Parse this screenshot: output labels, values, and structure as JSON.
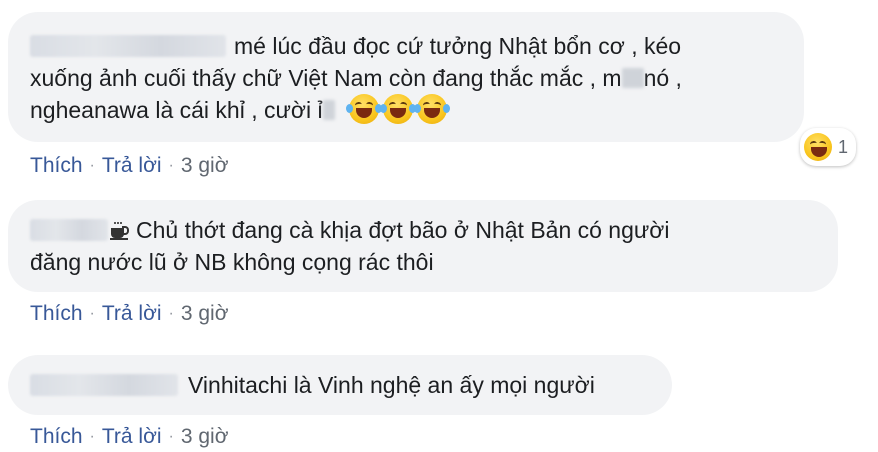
{
  "comments": [
    {
      "text_1": "mé lúc đầu đọc cứ tưởng Nhật bổn cơ , kéo",
      "text_2": "xuống ảnh cuối thấy chữ Việt Nam còn đang thắc mắc , m",
      "text_2b": "nó ,",
      "text_3": "ngheanawa là cái khỉ , cười ỉ",
      "emojis": [
        "laughing-tears",
        "laughing-tears",
        "laughing-tears"
      ],
      "reaction": {
        "icon": "laughing-squint",
        "count": "1"
      },
      "like": "Thích",
      "reply": "Trả lời",
      "time": "3 giờ"
    },
    {
      "icon": "hot-beverage",
      "text_1": "Chủ thớt đang cà khịa đợt bão ở Nhật Bản có người",
      "text_2": "đăng nước lũ ở NB không cọng rác thôi",
      "like": "Thích",
      "reply": "Trả lời",
      "time": "3 giờ"
    },
    {
      "text_1": "Vinhitachi là Vinh nghệ an ấy mọi người",
      "like": "Thích",
      "reply": "Trả lời",
      "time": "3 giờ"
    }
  ],
  "colors": {
    "bubble": "#f2f3f5",
    "link": "#385898",
    "meta": "#606770"
  }
}
